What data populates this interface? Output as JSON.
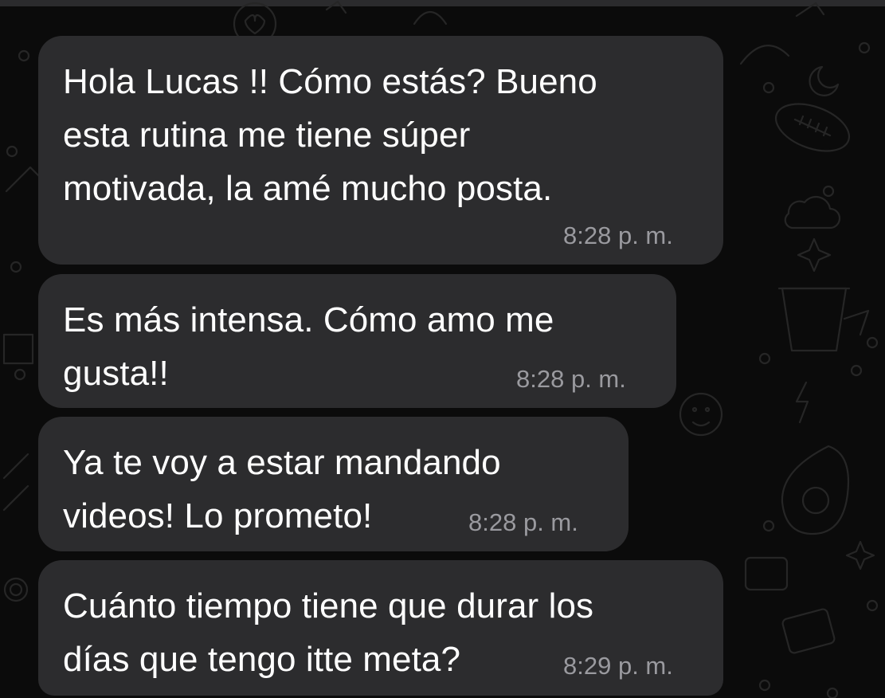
{
  "chat": {
    "background": "#0b0b0b",
    "bubble_color": "#2c2c2e",
    "text_color": "#ffffff",
    "time_color": "#9a9a9f",
    "messages": [
      {
        "text": "Hola Lucas !! Cómo estás? Bueno\nesta rutina me tiene súper\nmotivada, la amé mucho posta.",
        "time": "8:28 p. m."
      },
      {
        "text": "Es más intensa. Cómo amo me\ngusta!!",
        "time": "8:28 p. m."
      },
      {
        "text": "Ya te voy a estar mandando\nvideos! Lo prometo!",
        "time": "8:28 p. m."
      },
      {
        "text": "Cuánto tiempo tiene que durar los\ndías que tengo itte meta?",
        "time": "8:29 p. m."
      }
    ],
    "wallpaper_icons": [
      "heart-icon",
      "moon-icon",
      "football-icon",
      "flower-pot-icon",
      "cloud-icon",
      "star-icon",
      "lightning-icon",
      "avocado-icon",
      "camera-icon",
      "smiley-icon"
    ]
  }
}
